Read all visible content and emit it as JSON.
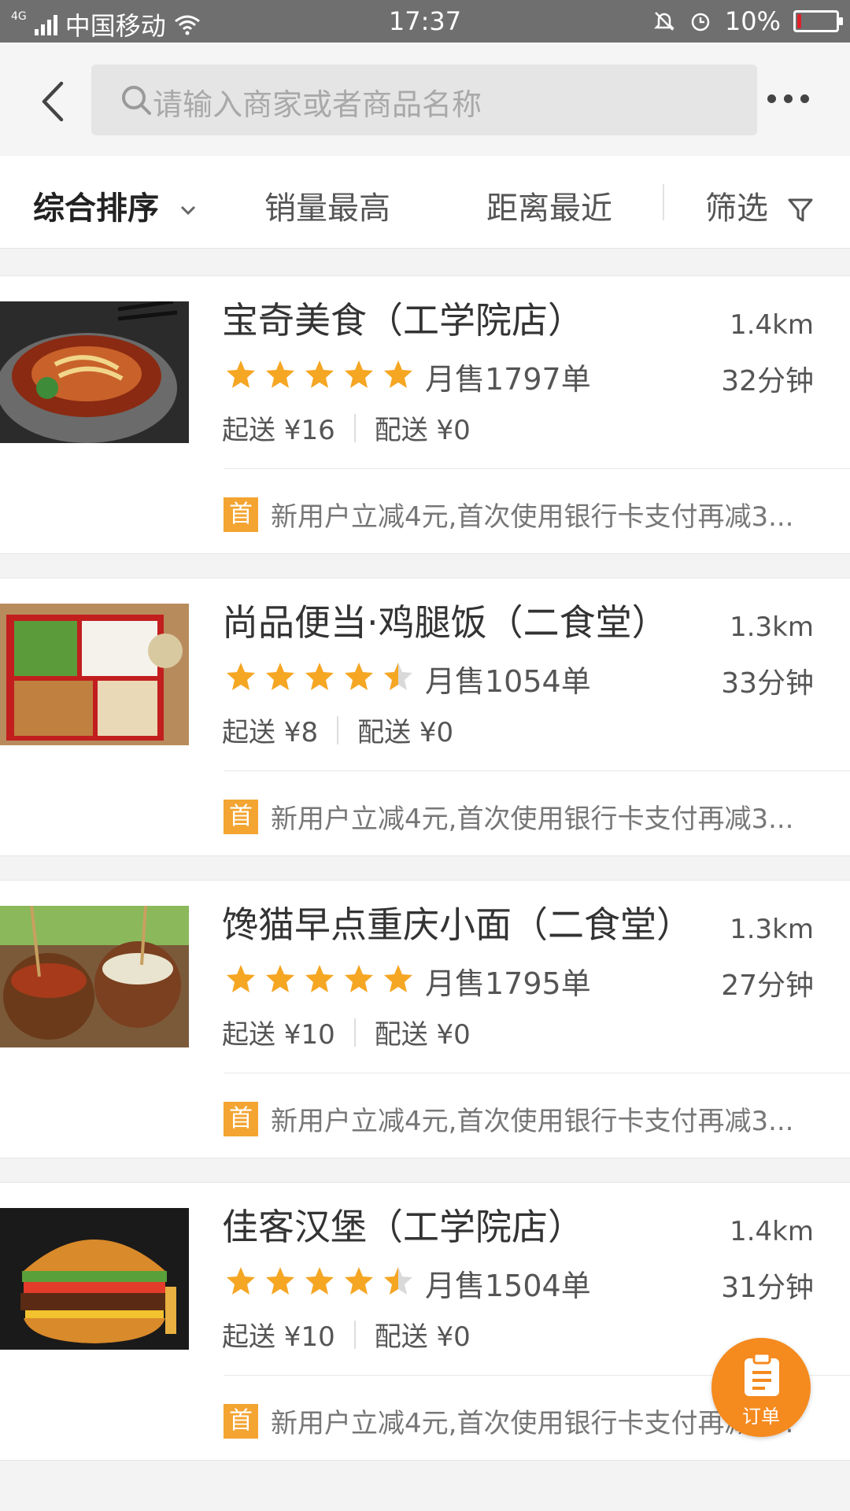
{
  "status_bar": {
    "network": "4G",
    "carrier": "中国移动",
    "time": "17:37",
    "battery": "10%",
    "battery_level": 0.1,
    "battery_color": "#e0212a"
  },
  "header": {
    "back_icon": "chevron-left-icon",
    "search_placeholder": "请输入商家或者商品名称",
    "more_icon": "more-dots-icon"
  },
  "sort_bar": {
    "comprehensive": "综合排序",
    "sales_highest": "销量最高",
    "distance_nearest": "距离最近",
    "filter": "筛选"
  },
  "stores": [
    {
      "name": "宝奇美食（工学院店）",
      "distance": "1.4km",
      "rating": 5,
      "monthly_sales": "月售1797单",
      "delivery_time": "32分钟",
      "min_order": "起送 ¥16",
      "delivery_fee": "配送 ¥0",
      "promo_badge": "首",
      "promo_text": "新用户立减4元,首次使用银行卡支付再减3..."
    },
    {
      "name": "尚品便当·鸡腿饭（二食堂）",
      "distance": "1.3km",
      "rating": 4.5,
      "monthly_sales": "月售1054单",
      "delivery_time": "33分钟",
      "min_order": "起送 ¥8",
      "delivery_fee": "配送 ¥0",
      "promo_badge": "首",
      "promo_text": "新用户立减4元,首次使用银行卡支付再减3..."
    },
    {
      "name": "馋猫早点重庆小面（二食堂）",
      "distance": "1.3km",
      "rating": 5,
      "monthly_sales": "月售1795单",
      "delivery_time": "27分钟",
      "min_order": "起送 ¥10",
      "delivery_fee": "配送 ¥0",
      "promo_badge": "首",
      "promo_text": "新用户立减4元,首次使用银行卡支付再减3..."
    },
    {
      "name": "佳客汉堡（工学院店）",
      "distance": "1.4km",
      "rating": 4.5,
      "monthly_sales": "月售1504单",
      "delivery_time": "31分钟",
      "min_order": "起送 ¥10",
      "delivery_fee": "配送 ¥0",
      "promo_badge": "首",
      "promo_text": "新用户立减4元,首次使用银行卡支付再减3..."
    }
  ],
  "order_button": {
    "label": "订单",
    "icon": "clipboard-icon"
  },
  "colors": {
    "accent": "#f58a1f",
    "star": "#f5a623",
    "promo_badge": "#f3a431"
  }
}
